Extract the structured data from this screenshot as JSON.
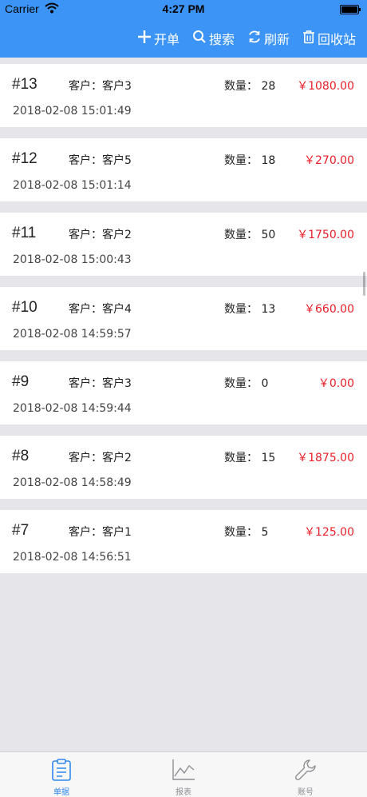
{
  "status_bar": {
    "carrier": "Carrier",
    "time": "4:27 PM"
  },
  "nav": {
    "actions": [
      {
        "icon": "plus-icon",
        "label": "开单"
      },
      {
        "icon": "search-icon",
        "label": "搜索"
      },
      {
        "icon": "refresh-icon",
        "label": "刷新"
      },
      {
        "icon": "trash-icon",
        "label": "回收站"
      }
    ]
  },
  "orders": [
    {
      "id": "#13",
      "customer": "客户：客户3",
      "quantity": "数量：  28",
      "amount": "￥1080.00",
      "datetime": "2018-02-08 15:01:49"
    },
    {
      "id": "#12",
      "customer": "客户：客户5",
      "quantity": "数量：  18",
      "amount": "￥270.00",
      "datetime": "2018-02-08 15:01:14"
    },
    {
      "id": "#11",
      "customer": "客户：客户2",
      "quantity": "数量：  50",
      "amount": "￥1750.00",
      "datetime": "2018-02-08 15:00:43"
    },
    {
      "id": "#10",
      "customer": "客户：客户4",
      "quantity": "数量：  13",
      "amount": "￥660.00",
      "datetime": "2018-02-08 14:59:57"
    },
    {
      "id": "#9",
      "customer": "客户：客户3",
      "quantity": "数量：  0",
      "amount": "￥0.00",
      "datetime": "2018-02-08 14:59:44"
    },
    {
      "id": "#8",
      "customer": "客户：客户2",
      "quantity": "数量：  15",
      "amount": "￥1875.00",
      "datetime": "2018-02-08 14:58:49"
    },
    {
      "id": "#7",
      "customer": "客户：客户1",
      "quantity": "数量：  5",
      "amount": "￥125.00",
      "datetime": "2018-02-08 14:56:51"
    }
  ],
  "tabs": [
    {
      "icon": "clipboard-icon",
      "label": "单据",
      "active": true
    },
    {
      "icon": "chart-icon",
      "label": "报表",
      "active": false
    },
    {
      "icon": "wrench-icon",
      "label": "账号",
      "active": false
    }
  ],
  "colors": {
    "accent": "#3c94f6",
    "amount": "#e8202a",
    "tab_active": "#2f88ee",
    "background": "#e5e5ea"
  }
}
